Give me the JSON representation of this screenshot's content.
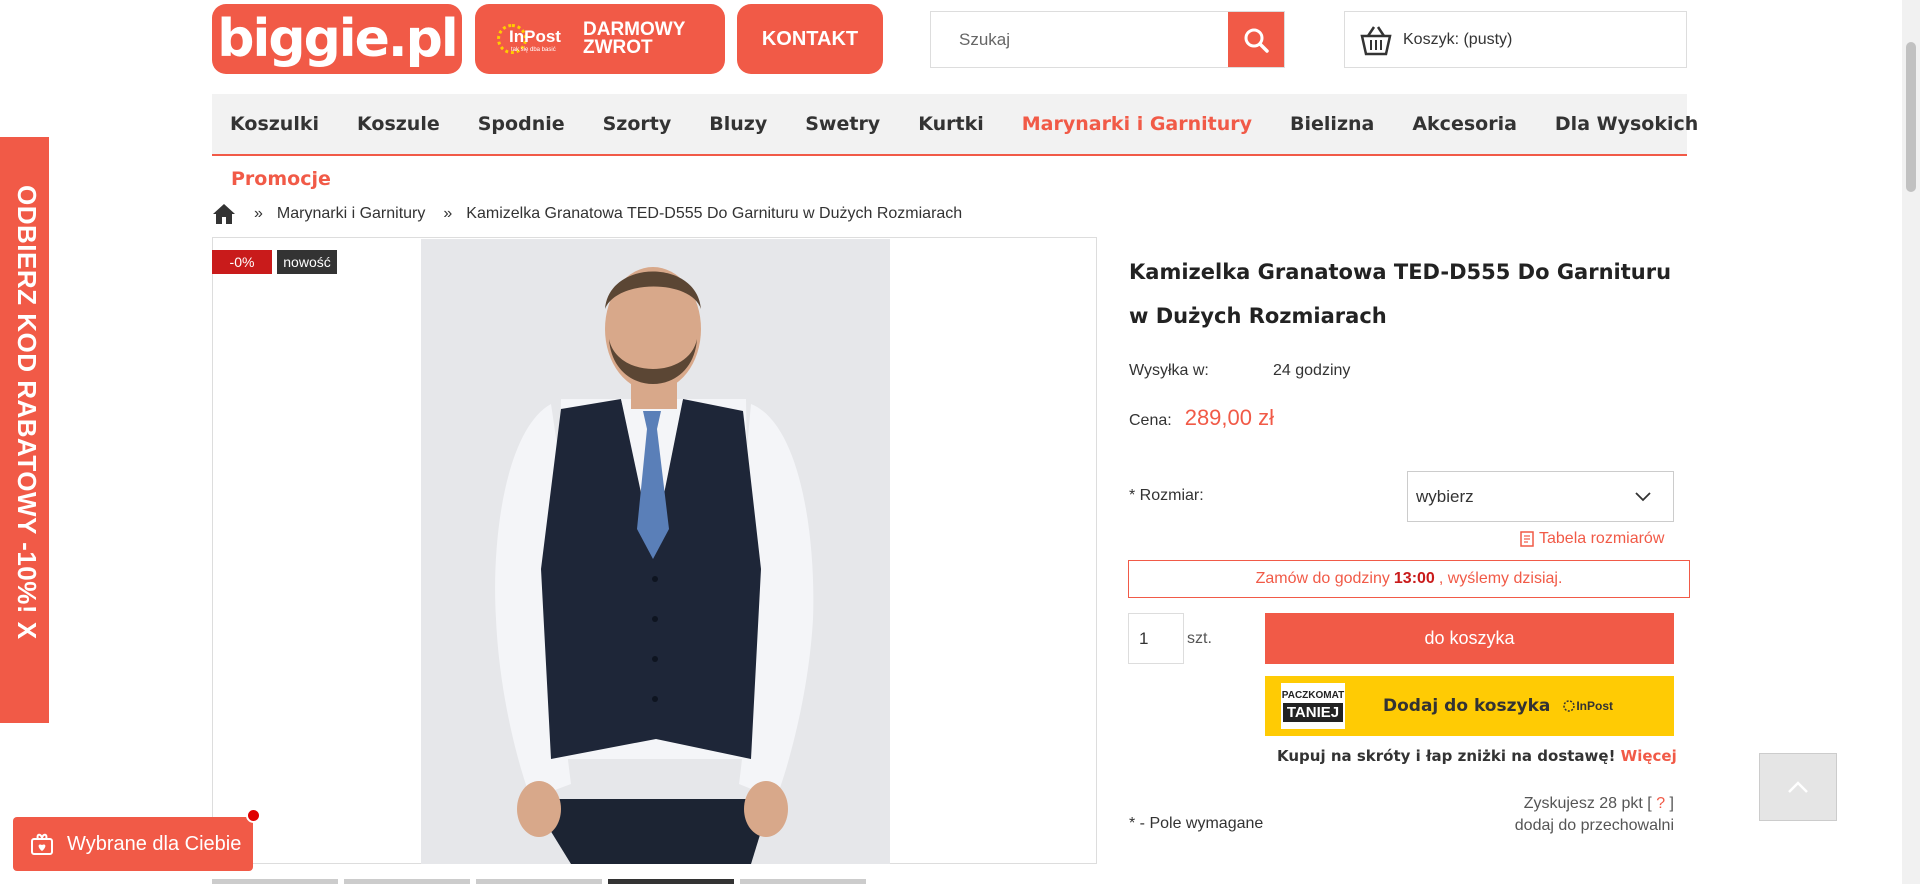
{
  "header": {
    "logo_text": "biggie.pl",
    "inpost_logo": "InPost",
    "inpost_logo_sub": "tak się dba basić",
    "inpost_line1": "DARMOWY",
    "inpost_line2": "ZWROT",
    "contact_label": "KONTAKT",
    "search_placeholder": "Szukaj",
    "cart_label": "Koszyk: (pusty)"
  },
  "nav": {
    "items": [
      "Koszulki",
      "Koszule",
      "Spodnie",
      "Szorty",
      "Bluzy",
      "Swetry",
      "Kurtki",
      "Marynarki i Garnitury",
      "Bielizna",
      "Akcesoria",
      "Dla Wysokich"
    ],
    "active_index": 7,
    "promo": "Promocje"
  },
  "breadcrumb": {
    "sep": "»",
    "category": "Marynarki i Garnitury",
    "current": "Kamizelka Granatowa TED-D555 Do Garnituru w Dużych Rozmiarach"
  },
  "side_promo": {
    "text": "ODBIERZ KOD RABATOWY -10%!  X"
  },
  "product": {
    "badge_discount": "-0%",
    "badge_new": "nowość",
    "title": "Kamizelka Granatowa TED-D555 Do Garnituru w Dużych Rozmiarach",
    "shipping_label": "Wysyłka w:",
    "shipping_value": "24 godziny",
    "price_label": "Cena:",
    "price_value": "289,00 zł",
    "size_label": "* Rozmiar:",
    "size_selected": "wybierz",
    "size_table_label": "Tabela rozmiarów",
    "order_note_pre": "Zamów do godziny",
    "order_note_time": "13:00",
    "order_note_post": ", wyślemy dzisiaj.",
    "qty_value": "1",
    "qty_unit": "szt.",
    "add_to_cart": "do koszyka",
    "paczkomat_line1": "PACZKOMAT",
    "paczkomat_line2": "TANIEJ",
    "inpost_add": "Dodaj do koszyka",
    "inpost_brand": "InPost",
    "inpost_note": "Kupuj na skróty i łap zniżki na dostawę!",
    "inpost_more": "Więcej",
    "points_text": "Zyskujesz 28 pkt [",
    "points_q": " ? ",
    "points_close": "]",
    "stash_label": "dodaj do przechowalni",
    "required_note": "* - Pole wymagane"
  },
  "floating": {
    "chosen_label": "Wybrane dla Ciebie"
  },
  "colors": {
    "accent": "#f15a47",
    "badge_red": "#c91b1b",
    "inpost_yellow": "#ffcb04"
  },
  "thumbnails": {
    "count": 5,
    "active_index": 3
  }
}
